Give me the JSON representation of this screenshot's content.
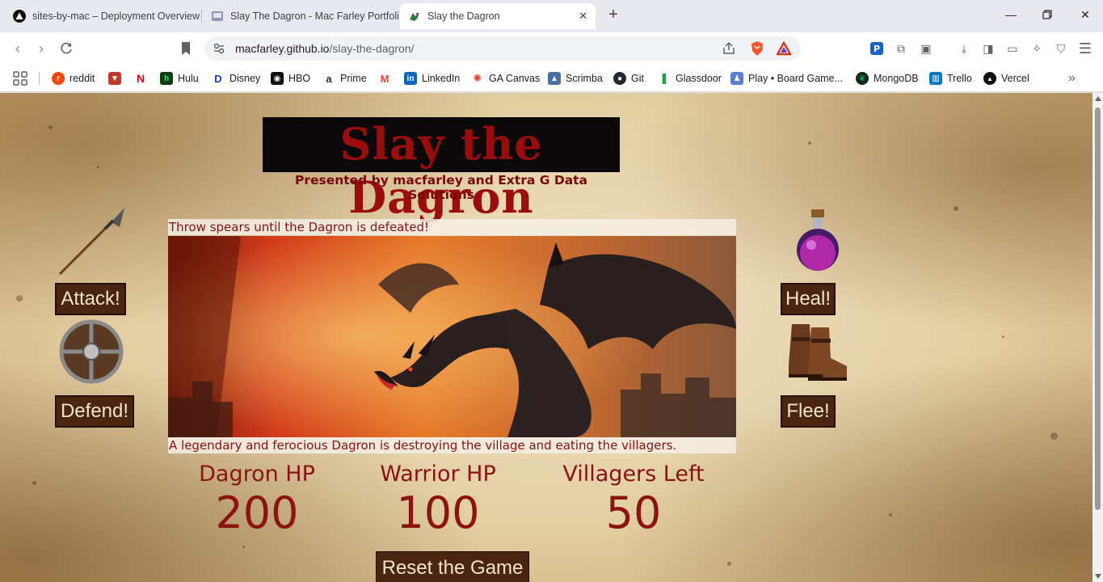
{
  "browser": {
    "tabs": [
      {
        "title": "sites-by-mac – Deployment Overview",
        "icon": "vercel-icon"
      },
      {
        "title": "Slay The Dagron - Mac Farley Portfolio",
        "icon": "portfolio-icon"
      },
      {
        "title": "Slay the Dagron",
        "icon": "dragon-icon",
        "active": true
      }
    ],
    "url_host": "macfarley.github.io",
    "url_path": "/slay-the-dagron/",
    "bookmarks": [
      {
        "label": "reddit",
        "icon": "reddit-icon",
        "color": "#ff4500"
      },
      {
        "label": "",
        "icon": "fox-icon",
        "color": "#c0392b"
      },
      {
        "label": "",
        "icon": "netflix-icon",
        "color": "#e50914"
      },
      {
        "label": "Hulu",
        "icon": "hulu-icon",
        "color": "#1ce783"
      },
      {
        "label": "Disney",
        "icon": "disney-icon",
        "color": "#113ccf"
      },
      {
        "label": "HBO",
        "icon": "hbo-icon",
        "color": "#000000"
      },
      {
        "label": "Prime",
        "icon": "amazon-icon",
        "color": "#232f3e"
      },
      {
        "label": "",
        "icon": "gmail-icon",
        "color": "#ea4335"
      },
      {
        "label": "LinkedIn",
        "icon": "linkedin-icon",
        "color": "#0a66c2"
      },
      {
        "label": "GA Canvas",
        "icon": "canvas-icon",
        "color": "#e4402e"
      },
      {
        "label": "Scrimba",
        "icon": "scrimba-icon",
        "color": "#4a6fa5"
      },
      {
        "label": "Git",
        "icon": "github-icon",
        "color": "#24292e"
      },
      {
        "label": "Glassdoor",
        "icon": "glassdoor-icon",
        "color": "#0caa41"
      },
      {
        "label": "Play • Board Game...",
        "icon": "boardgame-icon",
        "color": "#5a7bd6"
      },
      {
        "label": "MongoDB",
        "icon": "mongodb-icon",
        "color": "#13aa52"
      },
      {
        "label": "Trello",
        "icon": "trello-icon",
        "color": "#0079bf"
      },
      {
        "label": "Vercel",
        "icon": "vercel-icon",
        "color": "#000000"
      }
    ]
  },
  "game": {
    "title": "Slay the Dagron",
    "subtitle": "Presented by macfarley and Extra G Data Solutions",
    "top_message": "Throw spears until the Dagron is defeated!",
    "bottom_message": "A legendary and ferocious Dagron is destroying the village and eating the villagers.",
    "buttons": {
      "attack": "Attack!",
      "defend": "Defend!",
      "heal": "Heal!",
      "flee": "Flee!",
      "reset": "Reset the Game"
    },
    "stats": {
      "dagron_label": "Dagron HP",
      "dagron_value": "200",
      "warrior_label": "Warrior HP",
      "warrior_value": "100",
      "villagers_label": "Villagers Left",
      "villagers_value": "50"
    },
    "colors": {
      "title_red": "#9b0d0d",
      "text_red": "#8d1212",
      "button_brown": "#4a2512",
      "button_text": "#f1e4c6"
    }
  }
}
